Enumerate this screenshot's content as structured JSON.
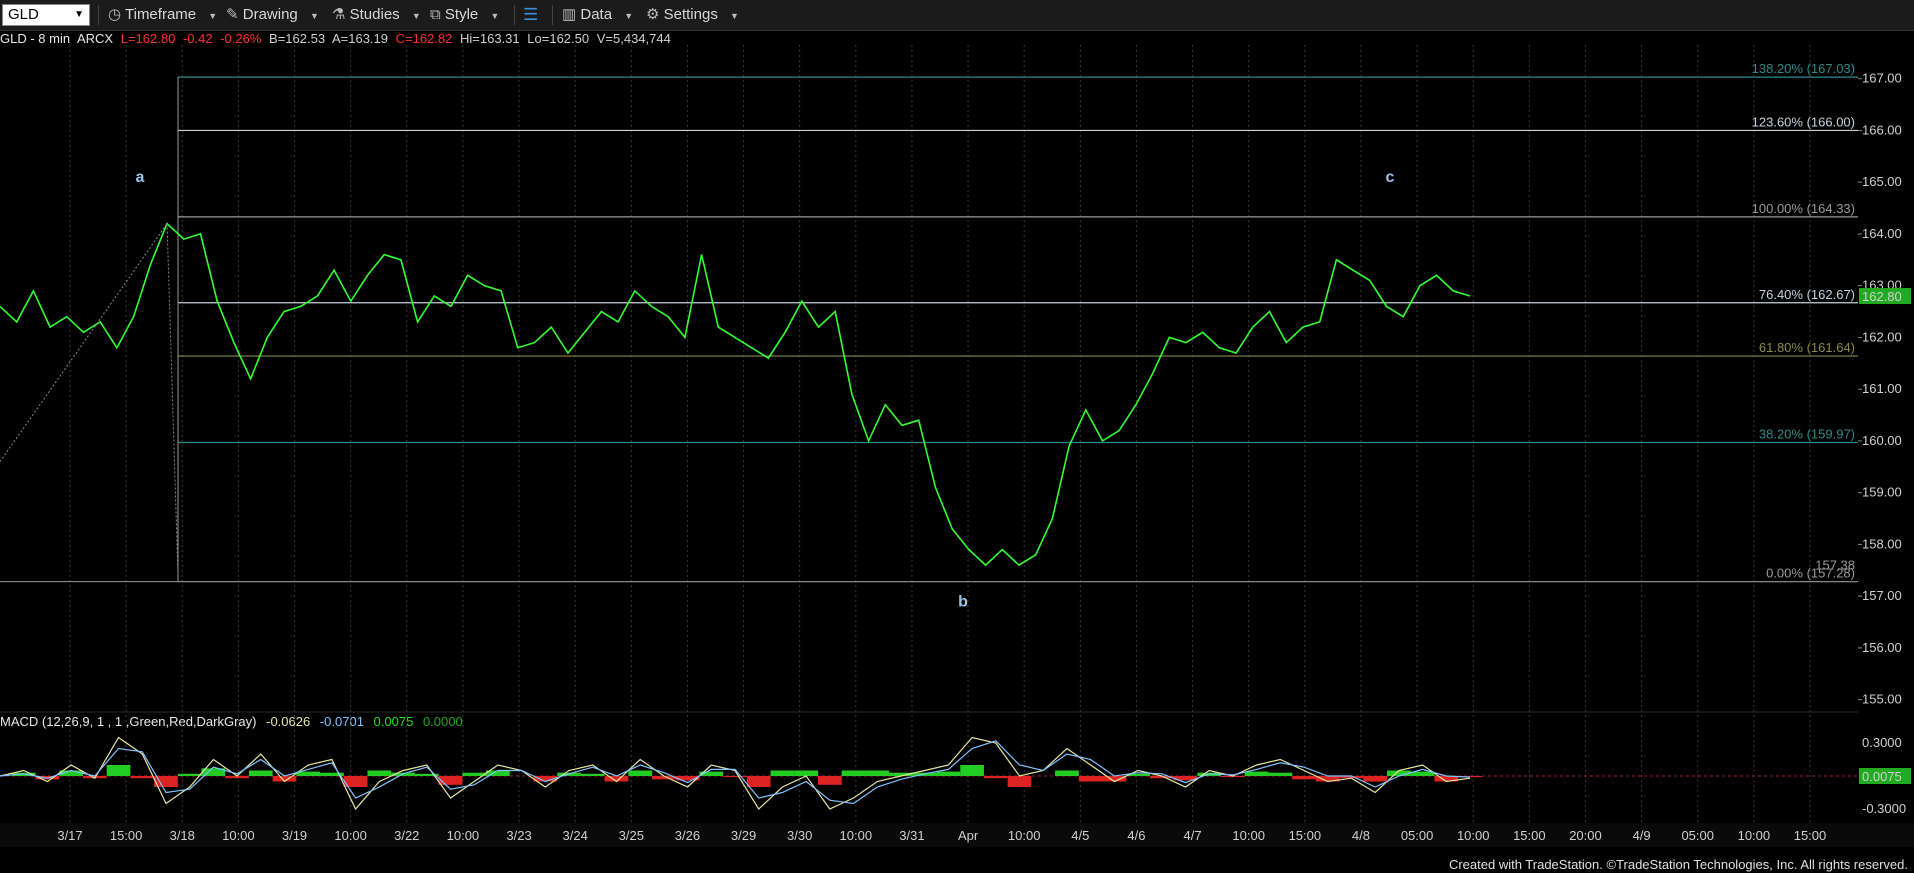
{
  "toolbar": {
    "symbol": "GLD",
    "timeframe": "Timeframe",
    "drawing": "Drawing",
    "studies": "Studies",
    "style": "Style",
    "data": "Data",
    "settings": "Settings"
  },
  "status": {
    "title": "GLD - 8 min",
    "exchange": "ARCX",
    "last": "L=162.80",
    "change": "-0.42",
    "change_pct": "-0.26%",
    "bid": "B=162.53",
    "ask": "A=163.19",
    "close": "C=162.82",
    "high": "Hi=163.31",
    "low": "Lo=162.50",
    "volume": "V=5,434,744",
    "up_color": "#d8d8d8",
    "down_color": "#ff3030"
  },
  "macd": {
    "label": "MACD (12,26,9, 1 , 1 ,Green,Red,DarkGray)",
    "v1": "-0.0626",
    "v2": "-0.0701",
    "v3": "0.0075",
    "v4": "0.0000",
    "current_tag": "0.0075"
  },
  "footer": "Created with TradeStation. ©TradeStation Technologies, Inc. All rights reserved.",
  "chart_data": {
    "type": "line",
    "title": "",
    "xlabel": "",
    "ylabel": "",
    "ylim": [
      154.8,
      167.4
    ],
    "y_ticks": [
      155,
      156,
      157,
      158,
      159,
      160,
      161,
      162,
      163,
      164,
      165,
      166,
      167
    ],
    "y_tick_labels": [
      "155.00",
      "156.00",
      "157.00",
      "158.00",
      "159.00",
      "160.00",
      "161.00",
      "162.00",
      "163.00",
      "164.00",
      "165.00",
      "166.00",
      "167.00"
    ],
    "current_price": "162.80",
    "x_tick_labels": [
      "3/17",
      "15:00",
      "3/18",
      "10:00",
      "3/19",
      "10:00",
      "3/22",
      "10:00",
      "3/23",
      "3/24",
      "3/25",
      "3/26",
      "3/29",
      "3/30",
      "10:00",
      "3/31",
      "Apr",
      "10:00",
      "4/5",
      "4/6",
      "4/7",
      "10:00",
      "15:00",
      "4/8",
      "05:00",
      "10:00",
      "15:00",
      "20:00",
      "4/9",
      "05:00",
      "10:00",
      "15:00"
    ],
    "fib_levels": [
      {
        "label": "138.20% (167.03)",
        "value": 167.03,
        "color": "#2e8a8a"
      },
      {
        "label": "123.60% (166.00)",
        "value": 166.0,
        "color": "#c8d0d8"
      },
      {
        "label": "100.00% (164.33)",
        "value": 164.33,
        "color": "#9a9a9a"
      },
      {
        "label": "76.40% (162.67)",
        "value": 162.67,
        "color": "#c8d0d8"
      },
      {
        "label": "61.80% (161.64)",
        "value": 161.64,
        "color": "#8a8a4a"
      },
      {
        "label": "38.20% (159.97)",
        "value": 159.97,
        "color": "#2e8a8a"
      },
      {
        "label": "0.00% (157.28)",
        "value": 157.28,
        "color": "#9a9a9a"
      }
    ],
    "low_marker": "157.38",
    "wave_labels": [
      {
        "text": "a",
        "value": 165.0
      },
      {
        "text": "b",
        "value": 156.8
      },
      {
        "text": "c",
        "value": 165.0
      }
    ],
    "series": [
      {
        "values": [
          162.6,
          162.3,
          162.9,
          162.2,
          162.4,
          162.1,
          162.3,
          161.8,
          162.4,
          163.4,
          164.2,
          163.9,
          164.0,
          162.7,
          161.9,
          161.2,
          162.0,
          162.5,
          162.6,
          162.8,
          163.3,
          162.7,
          163.2,
          163.6,
          163.5,
          162.3,
          162.8,
          162.6,
          163.2,
          163.0,
          162.9,
          161.8,
          161.9,
          162.2,
          161.7,
          162.1,
          162.5,
          162.3,
          162.9,
          162.6,
          162.4,
          162.0,
          163.6,
          162.2,
          162.0,
          161.8,
          161.6,
          162.1,
          162.7,
          162.2,
          162.5,
          160.9,
          160.0,
          160.7,
          160.3,
          160.4,
          159.1,
          158.3,
          157.9,
          157.6,
          157.9,
          157.6,
          157.8,
          158.5,
          159.9,
          160.6,
          160.0,
          160.2,
          160.7,
          161.3,
          162.0,
          161.9,
          162.1,
          161.8,
          161.7,
          162.2,
          162.5,
          161.9,
          162.2,
          162.3,
          163.5,
          163.3,
          163.1,
          162.6,
          162.4,
          163.0,
          163.2,
          162.9,
          162.8
        ]
      }
    ],
    "macd": {
      "ylim": [
        -0.4,
        0.4
      ],
      "y_tick_labels": [
        "0.3000",
        "-0.3000"
      ],
      "y_ticks": [
        0.3,
        -0.3
      ],
      "macd_line": [
        0.0,
        0.05,
        -0.05,
        0.1,
        -0.02,
        0.35,
        0.2,
        -0.25,
        -0.1,
        0.15,
        0.0,
        0.2,
        -0.05,
        0.1,
        0.15,
        -0.3,
        -0.05,
        0.05,
        0.1,
        -0.2,
        -0.05,
        0.1,
        0.05,
        -0.1,
        0.05,
        0.1,
        -0.05,
        0.15,
        0.0,
        -0.1,
        0.1,
        0.05,
        -0.3,
        -0.1,
        0.0,
        -0.3,
        -0.2,
        -0.05,
        0.0,
        0.05,
        0.1,
        0.35,
        0.3,
        0.0,
        0.05,
        0.25,
        0.1,
        -0.05,
        0.05,
        0.0,
        -0.1,
        0.05,
        0.0,
        0.1,
        0.15,
        0.05,
        -0.05,
        -0.02,
        -0.15,
        0.05,
        0.1,
        -0.05,
        -0.02
      ],
      "signal_line": [
        0.0,
        0.02,
        -0.02,
        0.05,
        0.0,
        0.25,
        0.22,
        -0.15,
        -0.12,
        0.08,
        0.02,
        0.15,
        0.0,
        0.06,
        0.12,
        -0.2,
        -0.1,
        0.02,
        0.08,
        -0.12,
        -0.08,
        0.05,
        0.05,
        -0.05,
        0.02,
        0.08,
        0.0,
        0.1,
        0.03,
        -0.06,
        0.06,
        0.06,
        -0.2,
        -0.15,
        -0.05,
        -0.22,
        -0.25,
        -0.1,
        -0.03,
        0.02,
        0.06,
        0.25,
        0.32,
        0.1,
        0.05,
        0.2,
        0.15,
        0.0,
        0.03,
        0.02,
        -0.06,
        0.02,
        0.01,
        0.06,
        0.12,
        0.08,
        0.0,
        0.0,
        -0.1,
        0.0,
        0.06,
        0.0,
        -0.01
      ]
    }
  }
}
